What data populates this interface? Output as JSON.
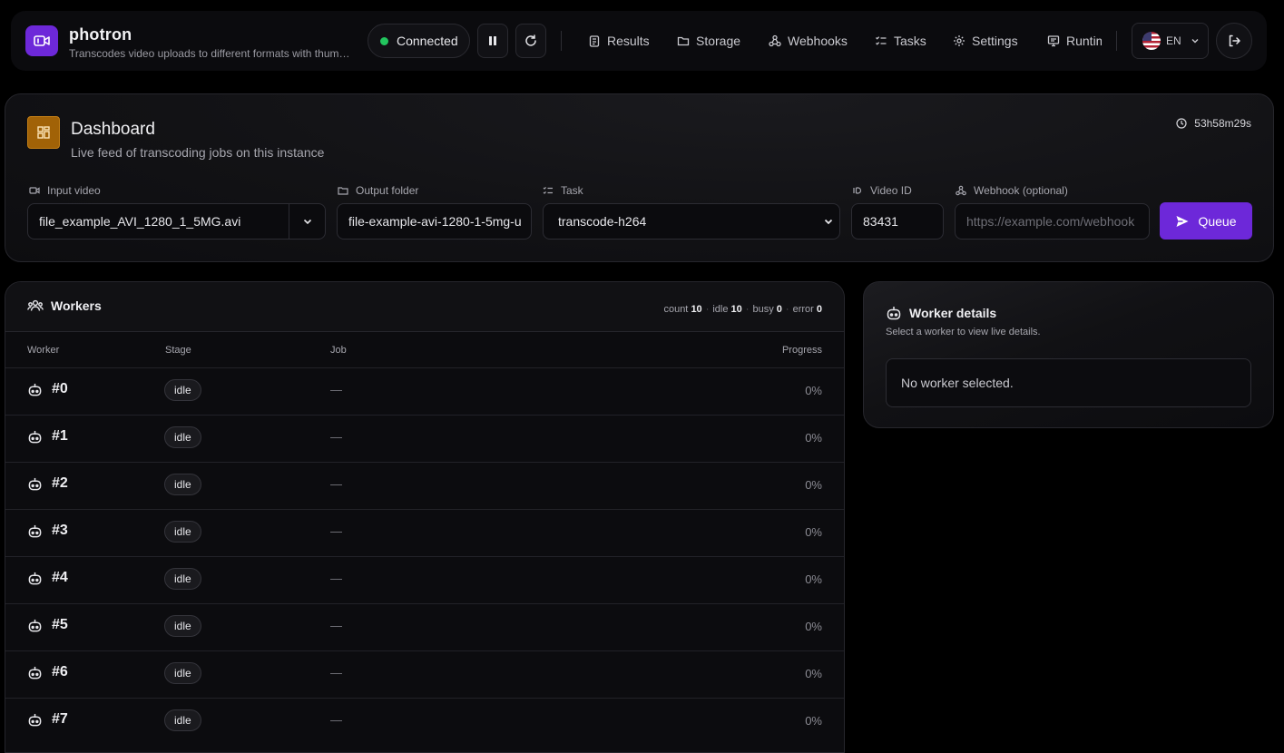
{
  "app": {
    "name": "photron",
    "subtitle": "Transcodes video uploads to different formats with thumbnails"
  },
  "header": {
    "status": "Connected",
    "nav": [
      "Results",
      "Storage",
      "Webhooks",
      "Tasks",
      "Settings",
      "Runtime"
    ],
    "language": "EN"
  },
  "dashboard": {
    "title": "Dashboard",
    "subtitle": "Live feed of transcoding jobs on this instance",
    "uptime": "53h58m29s",
    "fields": {
      "input_label": "Input video",
      "input_value": "file_example_AVI_1280_1_5MG.avi",
      "output_label": "Output folder",
      "output_value": "file-example-avi-1280-1-5mg-u",
      "task_label": "Task",
      "task_value": "transcode-h264",
      "videoid_label": "Video ID",
      "videoid_value": "83431",
      "webhook_label": "Webhook (optional)",
      "webhook_placeholder": "https://example.com/webhook"
    },
    "queue_label": "Queue"
  },
  "workers": {
    "title": "Workers",
    "stats": {
      "count_label": "count",
      "count": "10",
      "idle_label": "idle",
      "idle": "10",
      "busy_label": "busy",
      "busy": "0",
      "error_label": "error",
      "error": "0"
    },
    "columns": {
      "worker": "Worker",
      "stage": "Stage",
      "job": "Job",
      "progress": "Progress"
    },
    "rows": [
      {
        "id": "#0",
        "stage": "idle",
        "job": "—",
        "progress": "0%"
      },
      {
        "id": "#1",
        "stage": "idle",
        "job": "—",
        "progress": "0%"
      },
      {
        "id": "#2",
        "stage": "idle",
        "job": "—",
        "progress": "0%"
      },
      {
        "id": "#3",
        "stage": "idle",
        "job": "—",
        "progress": "0%"
      },
      {
        "id": "#4",
        "stage": "idle",
        "job": "—",
        "progress": "0%"
      },
      {
        "id": "#5",
        "stage": "idle",
        "job": "—",
        "progress": "0%"
      },
      {
        "id": "#6",
        "stage": "idle",
        "job": "—",
        "progress": "0%"
      },
      {
        "id": "#7",
        "stage": "idle",
        "job": "—",
        "progress": "0%"
      }
    ]
  },
  "details": {
    "title": "Worker details",
    "subtitle": "Select a worker to view live details.",
    "empty": "No worker selected."
  },
  "colors": {
    "accent": "#6d28d9",
    "status_ok": "#22c55e",
    "dashboard_icon": "#a16207"
  }
}
